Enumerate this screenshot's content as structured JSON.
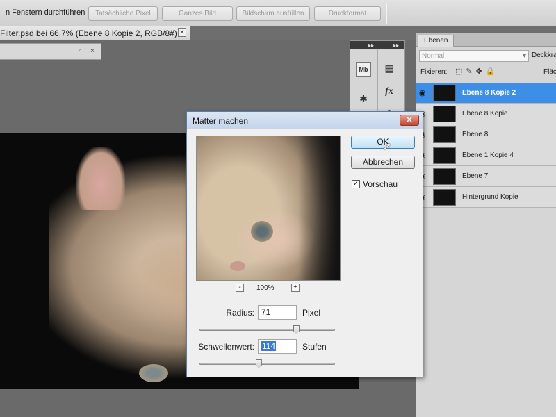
{
  "optionsbar": {
    "label": "n Fenstern durchführen",
    "buttons": [
      "Tatsächliche Pixel",
      "Ganzes Bild",
      "Bildschirm ausfüllen",
      "Druckformat"
    ]
  },
  "document": {
    "tab_title": "Filter.psd bei 66,7% (Ebene 8 Kopie 2, RGB/8#) *"
  },
  "layers_panel": {
    "tab": "Ebenen",
    "blend_mode": "Normal",
    "opacity_label": "Deckkra",
    "lock_label": "Fixieren:",
    "fill_label": "Fläch",
    "layers": [
      {
        "name": "Ebene 8 Kopie 2",
        "selected": true
      },
      {
        "name": "Ebene 8 Kopie",
        "selected": false
      },
      {
        "name": "Ebene 8",
        "selected": false
      },
      {
        "name": "Ebene 1 Kopie 4",
        "selected": false
      },
      {
        "name": "Ebene 7",
        "selected": false
      },
      {
        "name": "Hintergrund Kopie",
        "selected": false
      }
    ]
  },
  "dialog": {
    "title": "Matter machen",
    "close": "✕",
    "zoom": "100%",
    "zoom_minus": "-",
    "zoom_plus": "+",
    "ok": "OK",
    "cancel": "Abbrechen",
    "preview_label": "Vorschau",
    "preview_checked": true,
    "radius": {
      "label": "Radius:",
      "value": "71",
      "unit": "Pixel",
      "slider_fraction": 0.72
    },
    "threshold": {
      "label": "Schwellenwert:",
      "value": "114",
      "unit": "Stufen",
      "slider_fraction": 0.44
    }
  },
  "icons": [
    "mini-bridge-icon",
    "grid-icon",
    "settings-wheel-icon",
    "fx-icon",
    "info-icon"
  ],
  "colors": {
    "selection": "#3d8ee6",
    "dialog_title": "#c4d5ea",
    "close_button": "#c7452f"
  }
}
